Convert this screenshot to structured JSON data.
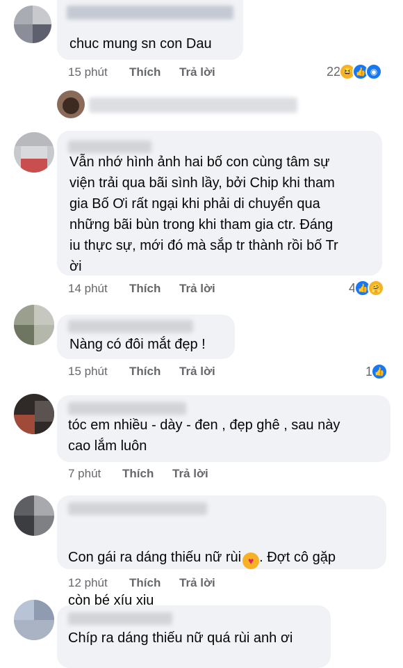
{
  "comments": [
    {
      "text": "chuc mung sn con Dau",
      "time": "15 phút",
      "like": "Thích",
      "reply": "Trả lời",
      "reactions": {
        "count": "22",
        "icons": [
          "haha-icon",
          "like-icon",
          "love-icon"
        ]
      }
    },
    {
      "text": "Vẫn nhớ hình ảnh hai bố con cùng tâm sự\nviện trải qua bãi sình lầy, bởi Chip khi tham\ngia Bố Ơi rất ngại khi phải di chuyển qua\nnhững bãi bùn trong khi tham gia ctr. Đáng\niu thực sự, mới đó mà sắp tr thành rồi bố Tr\nời",
      "time": "14 phút",
      "like": "Thích",
      "reply": "Trả lời",
      "reactions": {
        "count": "4",
        "icons": [
          "like-icon",
          "care-icon"
        ]
      }
    },
    {
      "text": "Nàng có đôi mắt đẹp !",
      "time": "15 phút",
      "like": "Thích",
      "reply": "Trả lời",
      "reactions": {
        "count": "1",
        "icons": [
          "like-icon"
        ]
      }
    },
    {
      "text": "tóc em nhiều - dày - đen , đẹp ghê , sau này\ncao lắm luôn",
      "time": "7 phút",
      "like": "Thích",
      "reply": "Trả lời"
    },
    {
      "text_line1": "Con gái ra dáng thiếu nữ rùi",
      "text_line1_after": ". Đợt cô gặp",
      "text_line2": "còn bé xíu xiu",
      "time": "12 phút",
      "like": "Thích",
      "reply": "Trả lời"
    },
    {
      "text": "Chíp ra dáng thiếu nữ quá rùi anh ơi"
    }
  ]
}
